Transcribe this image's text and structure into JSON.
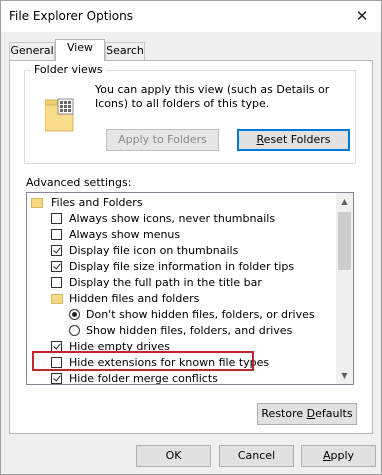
{
  "window": {
    "title": "File Explorer Options",
    "close_glyph": "✕"
  },
  "tabs": [
    {
      "label": "General"
    },
    {
      "label": "View"
    },
    {
      "label": "Search"
    }
  ],
  "folder_views": {
    "legend": "Folder views",
    "description": "You can apply this view (such as Details or Icons) to all folders of this type.",
    "apply_button": "Apply to Folders",
    "reset_button_prefix": "",
    "reset_button_underline": "R",
    "reset_button_rest": "eset Folders"
  },
  "advanced": {
    "label": "Advanced settings:",
    "items": [
      {
        "text": "Files and Folders",
        "kind": "folder"
      },
      {
        "text": "Always show icons, never thumbnails",
        "kind": "checkbox",
        "checked": false
      },
      {
        "text": "Always show menus",
        "kind": "checkbox",
        "checked": false
      },
      {
        "text": "Display file icon on thumbnails",
        "kind": "checkbox",
        "checked": true
      },
      {
        "text": "Display file size information in folder tips",
        "kind": "checkbox",
        "checked": true
      },
      {
        "text": "Display the full path in the title bar",
        "kind": "checkbox",
        "checked": false
      },
      {
        "text": "Hidden files and folders",
        "kind": "folder"
      },
      {
        "text": "Don't show hidden files, folders, or drives",
        "kind": "radio",
        "checked": true
      },
      {
        "text": "Show hidden files, folders, and drives",
        "kind": "radio",
        "checked": false
      },
      {
        "text": "Hide empty drives",
        "kind": "checkbox",
        "checked": true
      },
      {
        "text": "Hide extensions for known file types",
        "kind": "checkbox",
        "checked": false
      },
      {
        "text": "Hide folder merge conflicts",
        "kind": "checkbox",
        "checked": true
      }
    ]
  },
  "buttons": {
    "restore_defaults_prefix": "Restore ",
    "restore_defaults_underline": "D",
    "restore_defaults_rest": "efaults",
    "ok": "OK",
    "cancel": "Cancel",
    "apply_underline": "A",
    "apply_rest": "pply"
  },
  "colors": {
    "highlight": "#c0272d",
    "focus": "#0078d7"
  }
}
